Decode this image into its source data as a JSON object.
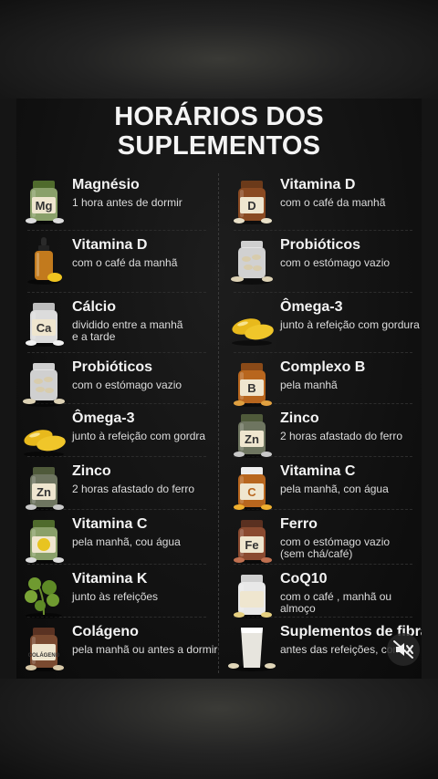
{
  "title_lines": [
    "HORÁRIOS DOS",
    "SUPLEMENTOS"
  ],
  "left_column": [
    {
      "name": "Magnésio",
      "desc": "1 hora antes de dormir",
      "icon": "magnesium-jar-icon",
      "label": "Mg"
    },
    {
      "name": "Vitamina D",
      "desc": "com o café da manhã",
      "icon": "dropper-bottle-icon"
    },
    {
      "name": "Cálcio",
      "desc": "dividido entre a manhã\ne a tarde",
      "icon": "calcium-jar-icon",
      "label": "Ca"
    },
    {
      "name": "Probióticos",
      "desc": "com o estómago vazio",
      "icon": "probiotic-capsules-icon"
    },
    {
      "name": "Ômega-3",
      "desc": "junto à refeição com gordra",
      "icon": "omega-softgel-icon"
    },
    {
      "name": "Zinco",
      "desc": "2 horas afastado do ferro",
      "icon": "zinc-jar-icon",
      "label": "Zn"
    },
    {
      "name": "Vitamina C",
      "desc": "pela manhã, cou água",
      "icon": "vitamin-c-jar-icon"
    },
    {
      "name": "Vitamina K",
      "desc": "junto às refeições",
      "icon": "leafy-greens-icon"
    },
    {
      "name": "Colágeno",
      "desc": "pela manhã ou antes a dormir",
      "icon": "collagen-jar-icon",
      "label": "COLÁGENO"
    }
  ],
  "right_column": [
    {
      "name": "Vitamina D",
      "desc": "com o café da manhã",
      "icon": "vitamin-d-jar-icon",
      "label": "D"
    },
    {
      "name": "Probióticos",
      "desc": "com o estómago vazio",
      "icon": "probiotic-jar-icon"
    },
    {
      "name": "Ômega-3",
      "desc": "junto à refeição com gordura",
      "icon": "omega-softgel-icon"
    },
    {
      "name": "Complexo B",
      "desc": "pela manhã",
      "icon": "b-complex-jar-icon",
      "label": "B"
    },
    {
      "name": "Zinco",
      "desc": "2 horas afastado do ferro",
      "icon": "zinc-jar-icon",
      "label": "Zn"
    },
    {
      "name": "Vitamina C",
      "desc": "pela manhã, con água",
      "icon": "vitamin-c-jar-icon",
      "label": "C"
    },
    {
      "name": "Ferro",
      "desc": "com o estómago vazio\n(sem chá/café)",
      "icon": "iron-jar-icon",
      "label": "Fe"
    },
    {
      "name": "CoQ10",
      "desc": "com o café , manhã ou almoço",
      "icon": "coq10-jar-icon"
    },
    {
      "name": "Suplementos de fibra",
      "desc": "antes das refeições, com o",
      "icon": "fiber-glass-icon"
    }
  ],
  "controls": {
    "mute_icon": "speaker-muted-icon"
  },
  "colors": {
    "background": "#151515",
    "amber_jar": "#b8661e",
    "green_cap": "#4f6b2c",
    "softgel": "#e8b91c"
  }
}
